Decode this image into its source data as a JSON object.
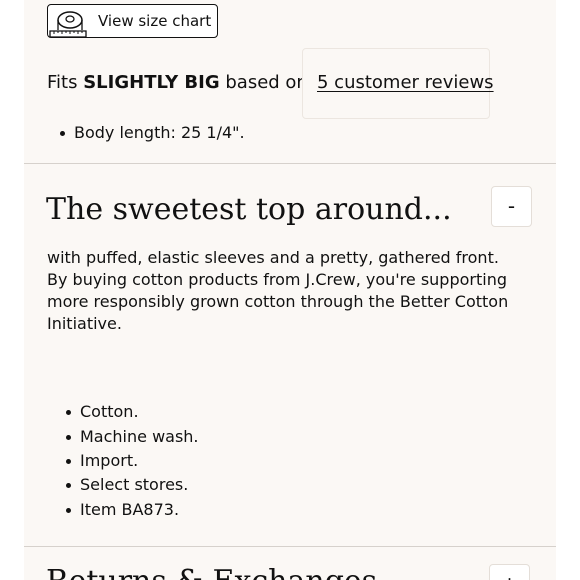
{
  "size_chart": {
    "label": "View size chart",
    "icon": "measuring-tape-icon"
  },
  "fit": {
    "prefix": "Fits",
    "value": "SLIGHTLY BIG",
    "suffix": "based on",
    "reviews_link": "5 customer reviews"
  },
  "measurements": [
    "Body length: 25 1/4\"."
  ],
  "description_section": {
    "title": "The sweetest top around...",
    "toggle": "-",
    "body": "with puffed, elastic sleeves and a pretty, gathered front. By buying cotton products from J.Crew, you're supporting more responsibly grown cotton through the Better Cotton Initiative.",
    "details": [
      "Cotton.",
      "Machine wash.",
      "Import.",
      "Select stores.",
      "Item BA873."
    ]
  },
  "next_section": {
    "title": "Returns & Exchanges",
    "toggle": "+"
  },
  "colors": {
    "panel_background": "#fbf8f5",
    "text": "#111111",
    "divider": "#d6d1cc"
  }
}
